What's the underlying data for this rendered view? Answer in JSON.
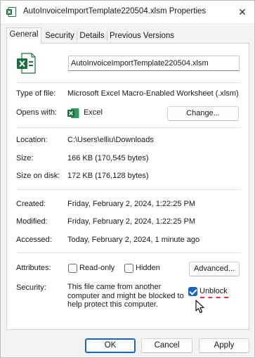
{
  "window": {
    "title": "AutoInvoiceImportTemplate220504.xlsm Properties",
    "close_glyph": "✕"
  },
  "tabs": [
    {
      "label": "General",
      "active": true
    },
    {
      "label": "Security",
      "active": false
    },
    {
      "label": "Details",
      "active": false
    },
    {
      "label": "Previous Versions",
      "active": false
    }
  ],
  "general": {
    "file_name": "AutoInvoiceImportTemplate220504.xlsm",
    "type_of_file_label": "Type of file:",
    "type_of_file_value": "Microsoft Excel Macro-Enabled Worksheet (.xlsm)",
    "opens_with_label": "Opens with:",
    "opens_with_value": "Excel",
    "change_button": "Change...",
    "location_label": "Location:",
    "location_value": "C:\\Users\\elliu\\Downloads",
    "size_label": "Size:",
    "size_value": "166 KB (170,545 bytes)",
    "size_on_disk_label": "Size on disk:",
    "size_on_disk_value": "172 KB (176,128 bytes)",
    "created_label": "Created:",
    "created_value": "Friday, February 2, 2024, 1:22:25 PM",
    "modified_label": "Modified:",
    "modified_value": "Friday, February 2, 2024, 1:22:25 PM",
    "accessed_label": "Accessed:",
    "accessed_value": "Today, February 2, 2024, 1 minute ago",
    "attributes_label": "Attributes:",
    "readonly_label": "Read-only",
    "readonly_checked": false,
    "hidden_label": "Hidden",
    "hidden_checked": false,
    "advanced_button": "Advanced...",
    "security_label": "Security:",
    "security_text": "This file came from another computer and might be blocked to help protect this computer.",
    "unblock_label": "Unblock",
    "unblock_checked": true
  },
  "footer": {
    "ok": "OK",
    "cancel": "Cancel",
    "apply": "Apply"
  },
  "colors": {
    "accent": "#1a63c8",
    "excel_green": "#1d6f42",
    "annotation_red": "#e8303a"
  },
  "icons": {
    "app": "excel-file-icon",
    "opens_with": "excel-app-icon",
    "cursor": "mouse-pointer-icon"
  }
}
